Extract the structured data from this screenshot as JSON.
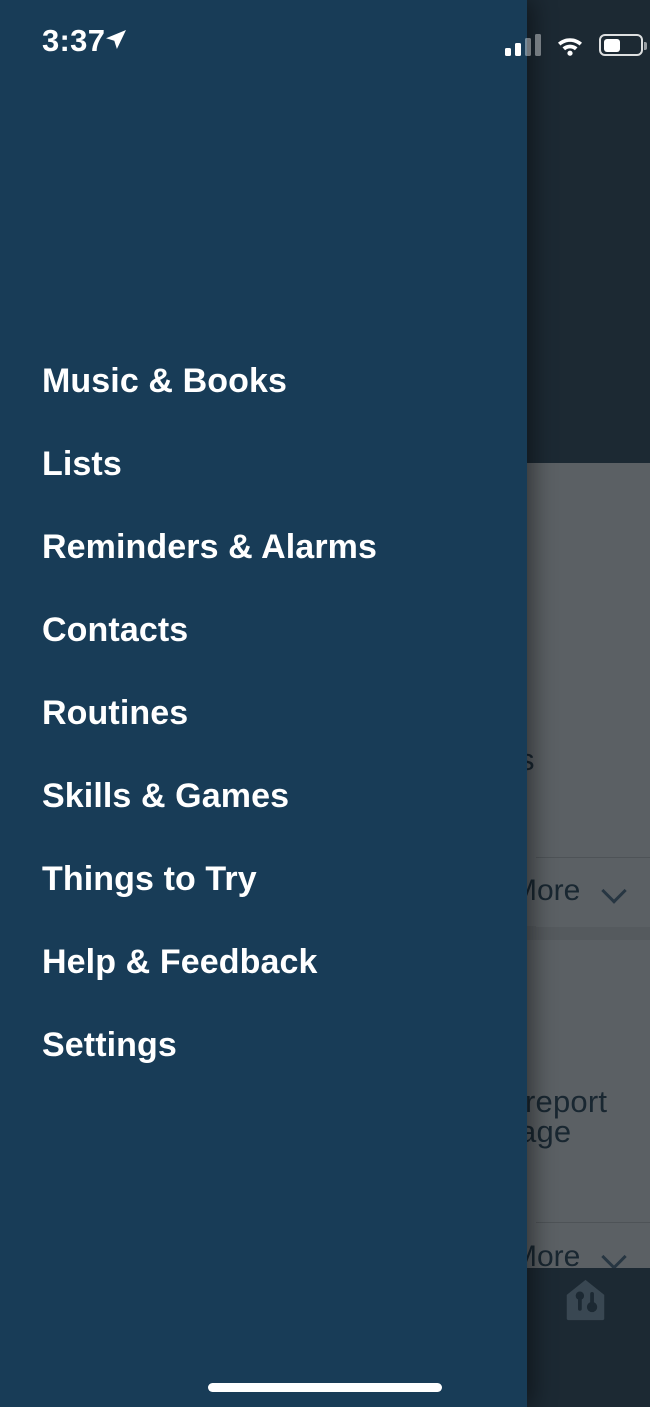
{
  "status_bar": {
    "time": "3:37",
    "location_icon": "location-arrow-icon",
    "cellular_icon": "cellular-signal-icon",
    "cellular_bars_filled": 2,
    "cellular_bars_total": 4,
    "wifi_icon": "wifi-icon",
    "battery_icon": "battery-icon",
    "battery_level_percent": 40
  },
  "drawer": {
    "menu_items": [
      {
        "label": "Music & Books",
        "name": "music-and-books"
      },
      {
        "label": "Lists",
        "name": "lists"
      },
      {
        "label": "Reminders & Alarms",
        "name": "reminders-and-alarms"
      },
      {
        "label": "Contacts",
        "name": "contacts"
      },
      {
        "label": "Routines",
        "name": "routines"
      },
      {
        "label": "Skills & Games",
        "name": "skills-and-games"
      },
      {
        "label": "Things to Try",
        "name": "things-to-try"
      },
      {
        "label": "Help & Feedback",
        "name": "help-and-feedback"
      },
      {
        "label": "Settings",
        "name": "settings"
      }
    ]
  },
  "background_app": {
    "card_one": {
      "clipped_text": "s",
      "more_label": "More",
      "more_chevron_icon": "chevron-down-icon"
    },
    "card_two": {
      "clipped_line_1": "report",
      "clipped_line_2": "age",
      "clipped_line_3": ".",
      "more_label": "More",
      "more_chevron_icon": "chevron-down-icon"
    },
    "tab_bar": {
      "devices_tab_icon": "home-devices-icon"
    }
  },
  "colors": {
    "drawer_bg": "#183c57",
    "scrim": "#25343f",
    "card_bg": "#9a9a9a",
    "text_on_drawer": "#ffffff",
    "text_on_card": "#20303c"
  },
  "home_indicator": {
    "name": "home-indicator"
  }
}
